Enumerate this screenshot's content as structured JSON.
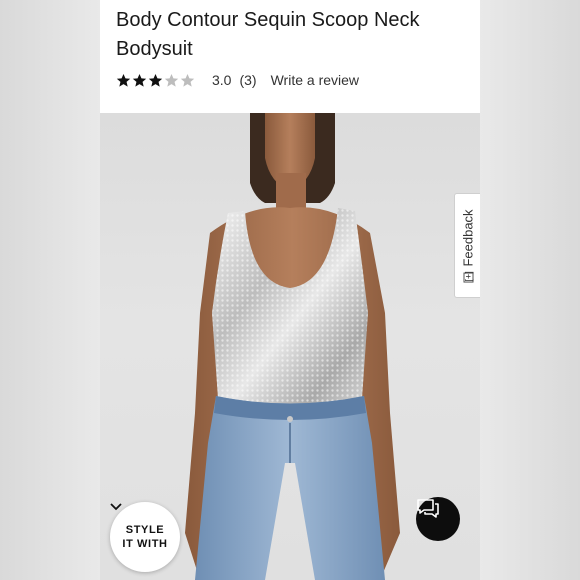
{
  "product": {
    "title": "Body Contour Sequin Scoop Neck Bodysuit",
    "rating_value": 3,
    "rating_max": 5,
    "rating_text": "3.0",
    "review_count": "(3)",
    "write_review": "Write a review"
  },
  "feedback": {
    "label": "Feedback",
    "icon": "[+]"
  },
  "style_button": {
    "line1": "STYLE",
    "line2": "IT WITH"
  },
  "chat_button": {
    "icon": "chat-bubbles-icon"
  },
  "colors": {
    "star_filled": "#111111",
    "star_empty": "#bdbdbd",
    "chat_bg": "#0d0d0d"
  }
}
